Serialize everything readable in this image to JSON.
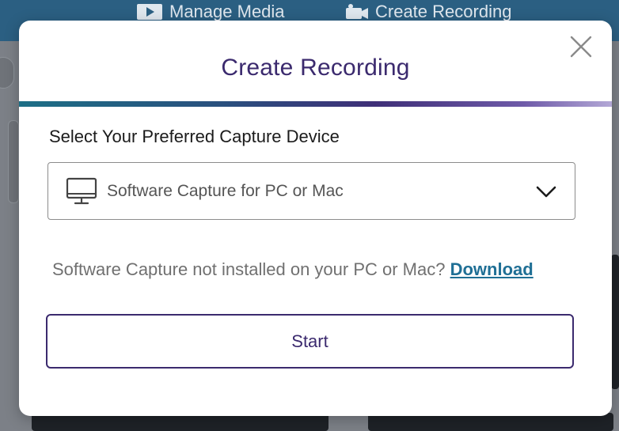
{
  "background": {
    "nav": {
      "manage_media": "Manage Media",
      "create_recording": "Create Recording"
    }
  },
  "modal": {
    "title": "Create Recording",
    "close_icon": "close-icon",
    "device_label": "Select Your Preferred Capture Device",
    "device_select": {
      "icon": "monitor-icon",
      "value": "Software Capture for PC or Mac",
      "dropdown_icon": "chevron-down-icon"
    },
    "download_prompt": "Software Capture not installed on your PC or Mac?",
    "download_link": "Download",
    "start_button": "Start"
  },
  "colors": {
    "title": "#3b2a6e",
    "link": "#1f6f95",
    "accent_gradient": [
      "#1d6f86",
      "#3f2f78",
      "#b3a8d6"
    ],
    "app_header": "#2b5f82"
  }
}
